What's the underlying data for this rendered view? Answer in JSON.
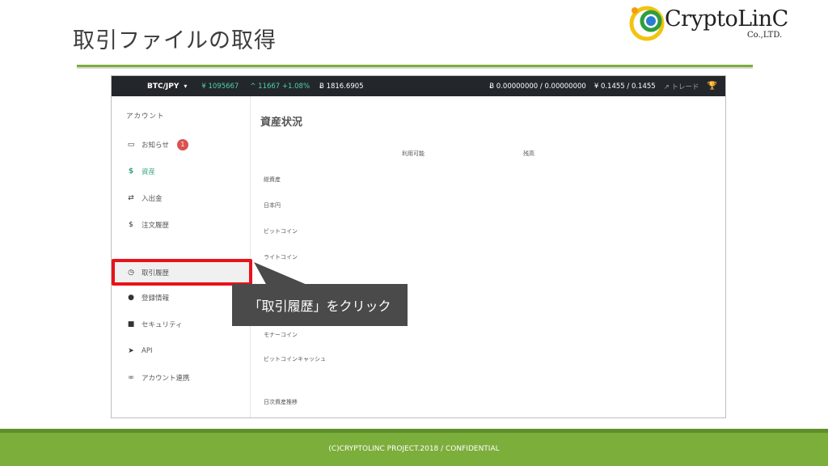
{
  "slide": {
    "title": "取引ファイルの取得",
    "logo_name": "CryptoLinC",
    "logo_sub": "Co.,LTD.",
    "callout": "「取引履歴」をクリック",
    "footer": "(C)CRYPTOLINC PROJECT.2018 / CONFIDENTIAL"
  },
  "topbar": {
    "pair": "BTC/JPY",
    "price": "¥ 1095667",
    "change": "^ 11667 +1.08%",
    "volume": "Ƀ 1816.6905",
    "btc_balance": "Ƀ 0.00000000 / 0.00000000",
    "jpy_balance": "¥ 0.1455 / 0.1455",
    "trade": "トレード"
  },
  "sidebar": {
    "heading": "アカウント",
    "items": [
      {
        "label": "お知らせ",
        "icon": "inbox-icon",
        "badge": "1"
      },
      {
        "label": "資産",
        "icon": "dollar-icon"
      },
      {
        "label": "入出金",
        "icon": "transfer-icon"
      },
      {
        "label": "注文履歴",
        "icon": "dollar-icon"
      },
      {
        "label": "取引履歴",
        "icon": "clock-icon"
      },
      {
        "label": "登録情報",
        "icon": "user-icon"
      },
      {
        "label": "セキュリティ",
        "icon": "lock-icon"
      },
      {
        "label": "API",
        "icon": "paper-plane-icon"
      },
      {
        "label": "アカウント連携",
        "icon": "link-icon"
      }
    ]
  },
  "main": {
    "title": "資産状況",
    "col_available": "利用可能",
    "col_balance": "残高",
    "rows": [
      "総資産",
      "日本円",
      "ビットコイン",
      "ライトコイン",
      "モナーコイン",
      "ビットコインキャッシュ",
      "日次資産推移"
    ]
  },
  "colors": {
    "accent_green": "#7cae3c",
    "topbar_bg": "#23272c",
    "price_green": "#4cd3a5",
    "highlight_red": "#e8121a"
  }
}
